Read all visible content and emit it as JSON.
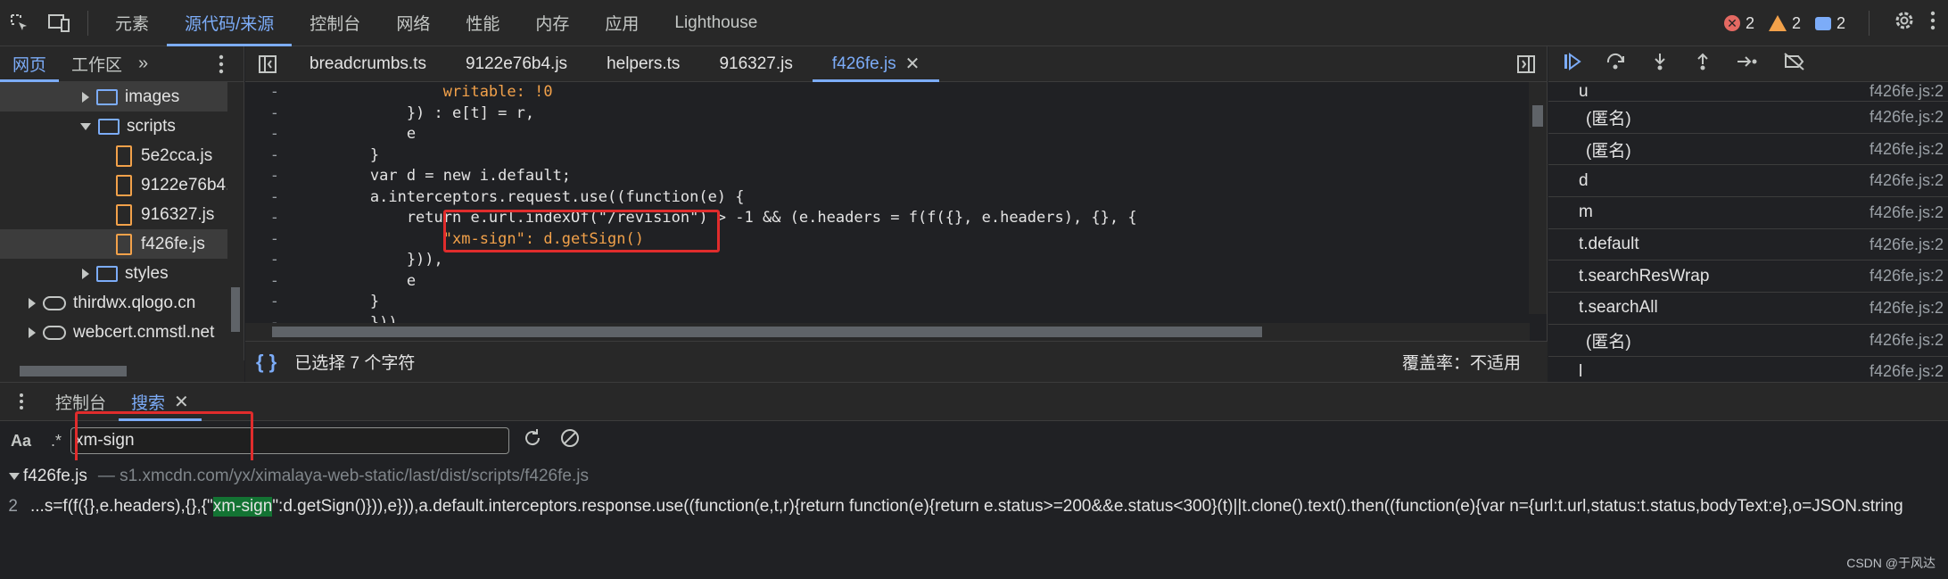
{
  "toolbar": {
    "tabs": [
      "元素",
      "源代码/来源",
      "控制台",
      "网络",
      "性能",
      "内存",
      "应用",
      "Lighthouse"
    ],
    "error_count": "2",
    "warning_count": "2",
    "message_count": "2"
  },
  "navigator": {
    "tabs": [
      "网页",
      "工作区"
    ],
    "tree": [
      "images",
      "scripts",
      "5e2cca.js",
      "9122e76b4.js",
      "916327.js",
      "f426fe.js",
      "styles",
      "thirdwx.qlogo.cn",
      "webcert.cnmstl.net"
    ]
  },
  "editor": {
    "tabs": [
      "breadcrumbs.ts",
      "9122e76b4.js",
      "helpers.ts",
      "916327.js",
      "f426fe.js"
    ],
    "active_tab": "f426fe.js",
    "gutter_marks": [
      "-",
      "-",
      "-",
      "-",
      "-",
      "-",
      "-",
      "-",
      "-",
      "-",
      "-",
      "-"
    ],
    "lines": [
      {
        "prefix": "                writable: !0",
        "rest": ""
      },
      {
        "prefix": "            }) : e[t] = r,",
        "rest": ""
      },
      {
        "prefix": "            e",
        "rest": ""
      },
      {
        "prefix": "        }",
        "rest": ""
      },
      {
        "prefix": "        var d = new i.default;",
        "rest": ""
      },
      {
        "prefix": "        a.interceptors.request.use((function(e) {",
        "rest": ""
      },
      {
        "prefix": "            return e.url.indexOf(\"/revision\") > -1 && (e.headers = f(f({}, e.headers), {}, {",
        "rest": ""
      },
      {
        "prefix": "                \"xm-sign\": d.getSign()",
        "rest": ""
      },
      {
        "prefix": "            })),",
        "rest": ""
      },
      {
        "prefix": "            e",
        "rest": ""
      },
      {
        "prefix": "        }",
        "rest": ""
      },
      {
        "prefix": "        }))",
        "rest": ""
      }
    ],
    "status_left": "已选择 7 个字符",
    "status_right": "覆盖率：不适用"
  },
  "call_stack": [
    {
      "name": "u",
      "location": "f426fe.js:2"
    },
    {
      "name": "(匿名)",
      "location": "f426fe.js:2"
    },
    {
      "name": "(匿名)",
      "location": "f426fe.js:2"
    },
    {
      "name": "d",
      "location": "f426fe.js:2"
    },
    {
      "name": "m",
      "location": "f426fe.js:2"
    },
    {
      "name": "t.default",
      "location": "f426fe.js:2"
    },
    {
      "name": "t.searchResWrap",
      "location": "f426fe.js:2"
    },
    {
      "name": "t.searchAll",
      "location": "f426fe.js:2"
    },
    {
      "name": "(匿名)",
      "location": "f426fe.js:2"
    },
    {
      "name": "l",
      "location": "f426fe.js:2"
    }
  ],
  "drawer": {
    "tabs": [
      "控制台",
      "搜索"
    ],
    "case_label": "Aa",
    "regex_label": ".*",
    "search_value": "xm-sign",
    "result_file": "f426fe.js",
    "result_path": "— s1.xmcdn.com/yx/ximalaya-web-static/last/dist/scripts/f426fe.js",
    "result_line_number": "2",
    "result_before": "...s=f(f({},e.headers),{},{\"",
    "result_match": "xm-sign",
    "result_after": "\":d.getSign()})),e})),a.default.interceptors.response.use((function(e,t,r){return function(e){return e.status>=200&&e.status<300}(t)||t.clone().text().then((function(e){var n={url:t.url,status:t.status,bodyText:e},o=JSON.string"
  },
  "watermark": "CSDN @于风达"
}
